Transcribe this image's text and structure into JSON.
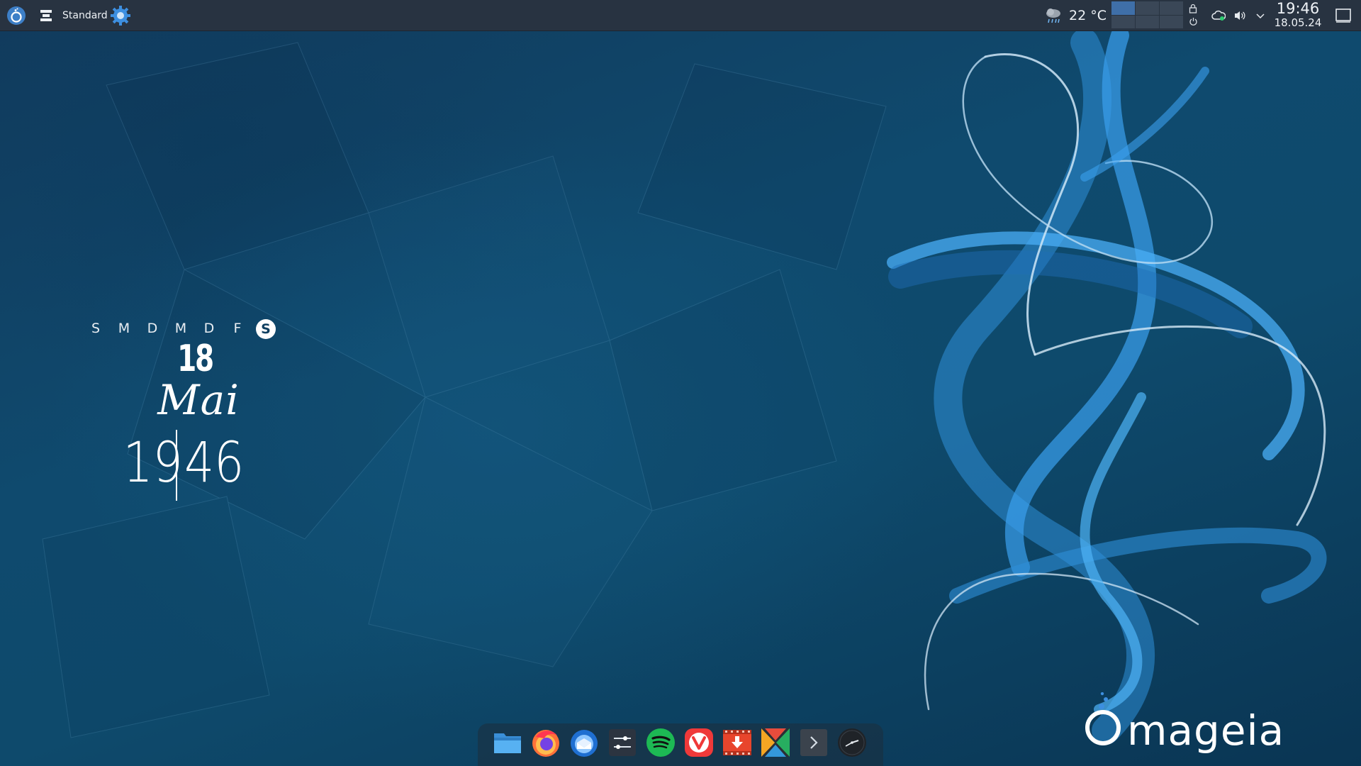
{
  "panel": {
    "activity_label": "Standard",
    "weather": {
      "icon": "rain-cloud-icon",
      "temperature": "22 °C"
    },
    "pager": {
      "desktops": 6,
      "active_index": 0
    },
    "clock": {
      "time": "19:46",
      "date": "18.05.24"
    }
  },
  "widget": {
    "weekdays": [
      "S",
      "M",
      "D",
      "M",
      "D",
      "F",
      "S"
    ],
    "today_index": 6,
    "day": "18",
    "month": "Mai",
    "hours": "19",
    "minutes": "46"
  },
  "dock": {
    "apps": [
      {
        "name": "files-icon"
      },
      {
        "name": "firefox-icon"
      },
      {
        "name": "thunderbird-icon"
      },
      {
        "name": "system-settings-icon"
      },
      {
        "name": "spotify-icon"
      },
      {
        "name": "vivaldi-icon"
      },
      {
        "name": "video-downloader-icon"
      },
      {
        "name": "kdenlive-icon"
      },
      {
        "name": "terminal-icon"
      },
      {
        "name": "clock-app-icon"
      }
    ]
  },
  "logo": {
    "text": "mageia"
  },
  "colors": {
    "panel_bg": "#283341",
    "accent": "#3daee9",
    "spotify": "#1db954",
    "vivaldi": "#ef3939"
  }
}
